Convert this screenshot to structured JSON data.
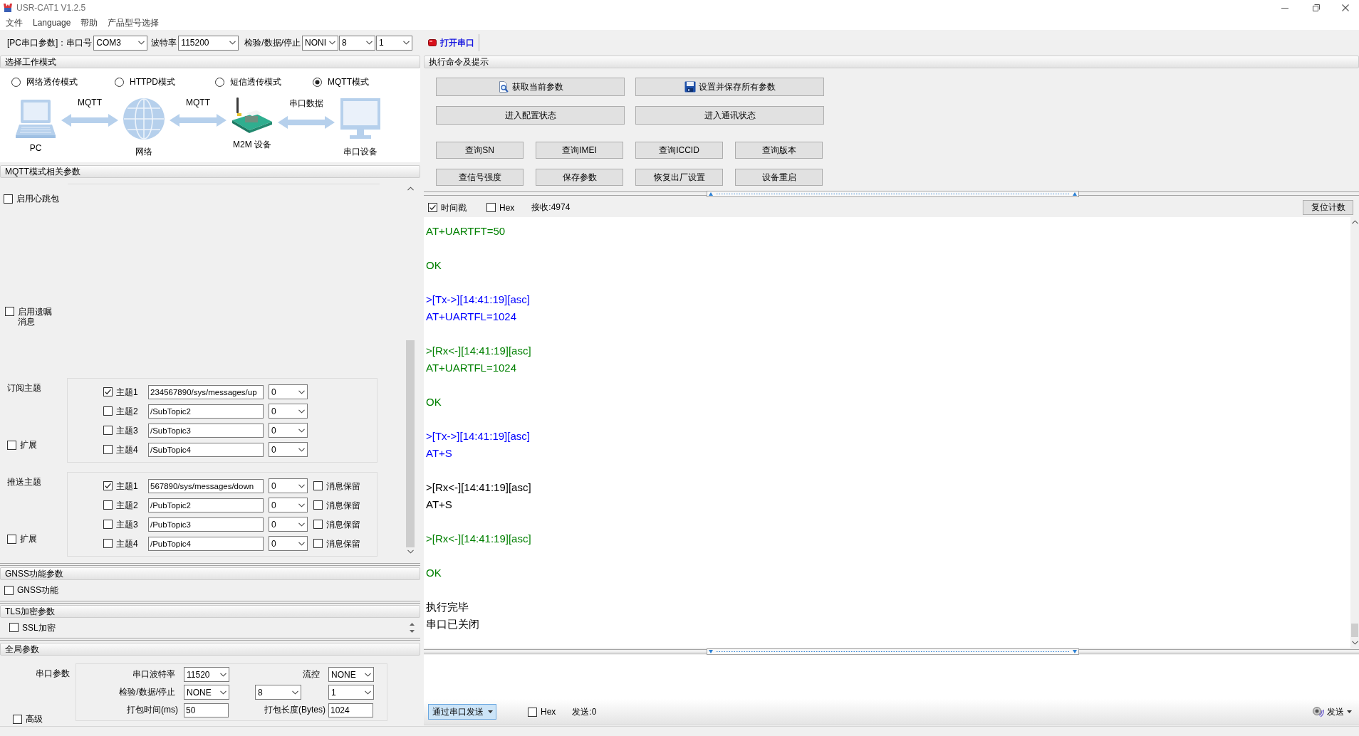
{
  "window": {
    "title": "USR-CAT1 V1.2.5"
  },
  "menu": [
    "文件",
    "Language",
    "帮助",
    "产品型号选择"
  ],
  "toolbar": {
    "port_label": "[PC串口参数]：串口号",
    "port": "COM3",
    "baud_label": "波特率",
    "baud": "115200",
    "format_label": "检验/数据/停止",
    "parity": "NONI",
    "data_bits": "8",
    "stop_bits": "1",
    "open_button": "打开串口"
  },
  "work_mode": {
    "title": "选择工作模式",
    "modes": [
      {
        "label": "网络透传模式",
        "selected": false
      },
      {
        "label": "HTTPD模式",
        "selected": false
      },
      {
        "label": "短信透传模式",
        "selected": false
      },
      {
        "label": "MQTT模式",
        "selected": true
      }
    ],
    "diagram": {
      "nodes": [
        "PC",
        "网络",
        "M2M 设备",
        "串口设备"
      ],
      "links": [
        "MQTT",
        "MQTT",
        "串口数据"
      ]
    }
  },
  "mqtt": {
    "title": "MQTT模式相关参数",
    "heartbeat": {
      "label": "启用心跳包",
      "checked": false
    },
    "will": {
      "label": "启用遗嘱消息",
      "checked": false
    },
    "subscribe": {
      "label": "订阅主题",
      "extend": {
        "label": "扩展",
        "checked": false
      },
      "topics": [
        {
          "label": "主题1",
          "checked": true,
          "value": "234567890/sys/messages/up",
          "qos": "0"
        },
        {
          "label": "主题2",
          "checked": false,
          "value": "/SubTopic2",
          "qos": "0"
        },
        {
          "label": "主题3",
          "checked": false,
          "value": "/SubTopic3",
          "qos": "0"
        },
        {
          "label": "主题4",
          "checked": false,
          "value": "/SubTopic4",
          "qos": "0"
        }
      ]
    },
    "publish": {
      "label": "推送主题",
      "extend": {
        "label": "扩展",
        "checked": false
      },
      "topics": [
        {
          "label": "主题1",
          "checked": true,
          "value": "567890/sys/messages/down",
          "qos": "0",
          "retain": {
            "label": "消息保留",
            "checked": false
          }
        },
        {
          "label": "主题2",
          "checked": false,
          "value": "/PubTopic2",
          "qos": "0",
          "retain": {
            "label": "消息保留",
            "checked": false
          }
        },
        {
          "label": "主题3",
          "checked": false,
          "value": "/PubTopic3",
          "qos": "0",
          "retain": {
            "label": "消息保留",
            "checked": false
          }
        },
        {
          "label": "主题4",
          "checked": false,
          "value": "/PubTopic4",
          "qos": "0",
          "retain": {
            "label": "消息保留",
            "checked": false
          }
        }
      ]
    }
  },
  "gnss": {
    "title": "GNSS功能参数",
    "enable": {
      "label": "GNSS功能",
      "checked": false
    }
  },
  "tls": {
    "title": "TLS加密参数",
    "enable": {
      "label": "SSL加密",
      "checked": false
    }
  },
  "global": {
    "title": "全局参数",
    "group_label": "串口参数",
    "baud_label": "串口波特率",
    "baud": "11520",
    "flow_label": "流控",
    "flow": "NONE",
    "format_label": "检验/数据/停止",
    "parity": "NONE",
    "data_bits": "8",
    "stop_bits": "1",
    "pack_time_label": "打包时间(ms)",
    "pack_time": "50",
    "pack_len_label": "打包长度(Bytes)",
    "pack_len": "1024",
    "advanced": {
      "label": "高级",
      "checked": false
    }
  },
  "commands": {
    "title": "执行命令及提示",
    "main_buttons": [
      {
        "label": "获取当前参数",
        "kind": "fetch"
      },
      {
        "label": "设置并保存所有参数",
        "kind": "save"
      },
      {
        "label": "进入配置状态",
        "kind": "plain"
      },
      {
        "label": "进入通讯状态",
        "kind": "plain"
      }
    ],
    "query_buttons": [
      "查询SN",
      "查询IMEI",
      "查询ICCID",
      "查询版本",
      "查信号强度",
      "保存参数",
      "恢复出厂设置",
      "设备重启"
    ]
  },
  "receive": {
    "timestamp": {
      "label": "时间戳",
      "checked": true
    },
    "hex": {
      "label": "Hex",
      "checked": false
    },
    "count": "接收:4974",
    "reset_button": "复位计数"
  },
  "log": [
    {
      "lines": [
        "AT+UARTFT=50"
      ],
      "color": "#008000"
    },
    {
      "lines": [
        "OK"
      ],
      "color": "#008000"
    },
    {
      "lines": [
        ">[Tx->][14:41:19][asc]",
        "AT+UARTFL=1024"
      ],
      "color": "#0000ff"
    },
    {
      "lines": [
        ">[Rx<-][14:41:19][asc]",
        "AT+UARTFL=1024"
      ],
      "color": "#008000"
    },
    {
      "lines": [
        "OK"
      ],
      "color": "#008000"
    },
    {
      "lines": [
        ">[Tx->][14:41:19][asc]",
        "AT+S"
      ],
      "color": "#0000ff"
    },
    {
      "lines": [
        ">[Rx<-][14:41:19][asc]",
        "AT+S"
      ],
      "color": "#000000"
    },
    {
      "lines": [
        ">[Rx<-][14:41:19][asc]"
      ],
      "color": "#008000"
    },
    {
      "lines": [
        "OK"
      ],
      "color": "#008000"
    },
    {
      "lines": [
        "执行完毕",
        "串口已关闭"
      ],
      "color": "#000000"
    }
  ],
  "send": {
    "mode_button": "通过串口发送",
    "hex": {
      "label": "Hex",
      "checked": false
    },
    "count": "发送:0",
    "send_button": "发送"
  }
}
